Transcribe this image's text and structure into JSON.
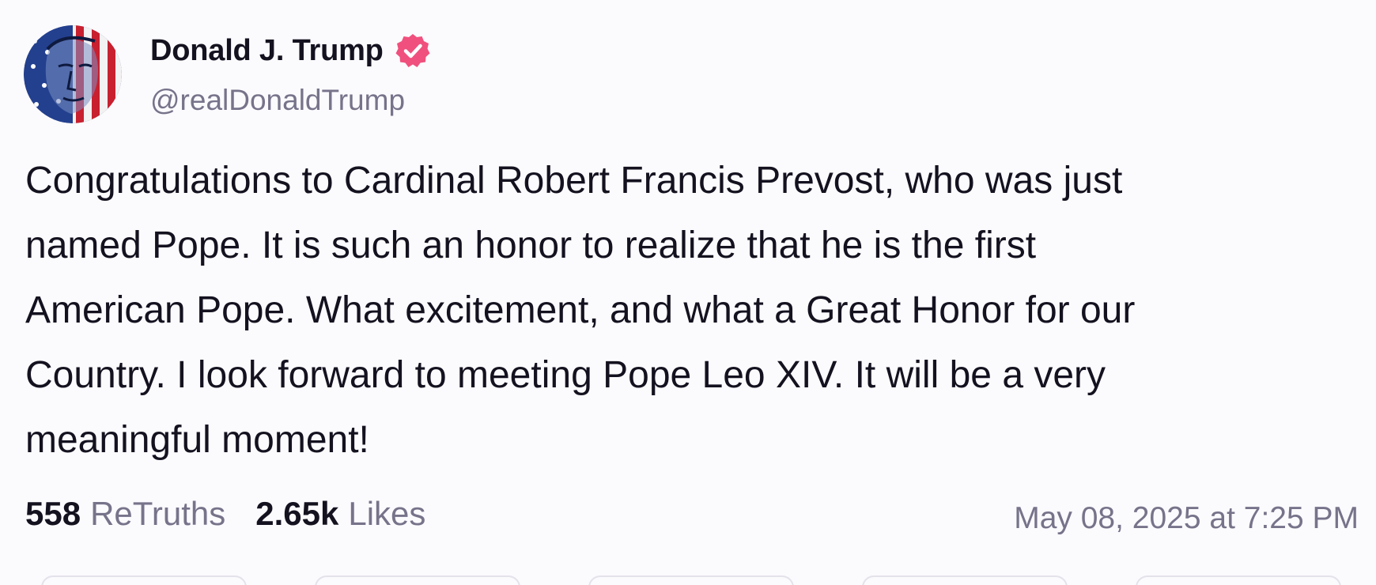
{
  "post": {
    "author": {
      "display_name": "Donald J. Trump",
      "handle": "@realDonaldTrump",
      "verified": true,
      "avatar": "avatar-portrait-flag"
    },
    "content_lines": [
      "Congratulations to Cardinal Robert Francis Prevost, who was just",
      "named Pope. It is such an honor to realize that he is the first",
      "American Pope. What excitement, and what a Great Honor for our",
      "Country. I look forward to meeting Pope Leo XIV. It will be a very",
      "meaningful moment!"
    ],
    "stats": {
      "retruths_count": "558",
      "retruths_label": "ReTruths",
      "likes_count": "2.65k",
      "likes_label": "Likes"
    },
    "timestamp": "May 08, 2025 at 7:25 PM"
  },
  "icons": {
    "verified": "verified-badge-icon"
  },
  "colors": {
    "background": "#fbfafd",
    "text": "#14121f",
    "muted": "#76738a",
    "verified_badge": "#f0507d"
  }
}
